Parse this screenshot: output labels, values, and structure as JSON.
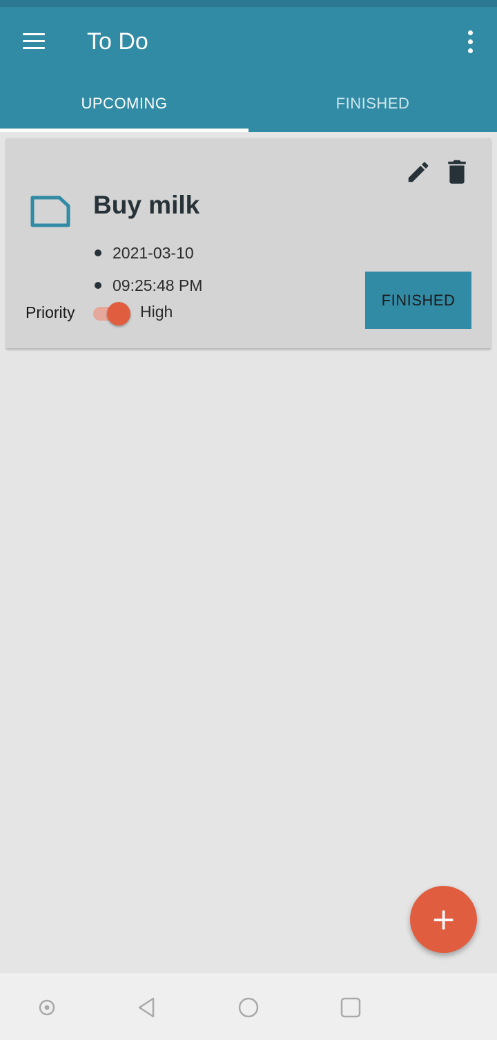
{
  "app": {
    "title": "To Do",
    "colors": {
      "primary": "#328ba5",
      "accent": "#e05d40",
      "background": "#e5e5e5",
      "card": "#d4d4d4"
    }
  },
  "toolbar": {
    "menu_icon": "hamburger-menu-icon",
    "overflow_icon": "more-vert-icon"
  },
  "tabs": [
    {
      "label": "UPCOMING",
      "active": true
    },
    {
      "label": "FINISHED",
      "active": false
    }
  ],
  "task": {
    "icon": "note-icon",
    "title": "Buy milk",
    "date": "2021-03-10",
    "time": "09:25:48 PM",
    "priority_label": "Priority",
    "priority_value": "High",
    "priority_on": true,
    "action_label": "FINISHED",
    "edit_icon": "pencil-icon",
    "delete_icon": "trash-icon"
  },
  "fab": {
    "icon": "plus-icon",
    "symbol": "+"
  },
  "system_nav": {
    "icons": [
      "assistant-dot-icon",
      "back-icon",
      "home-icon",
      "recents-icon"
    ]
  }
}
